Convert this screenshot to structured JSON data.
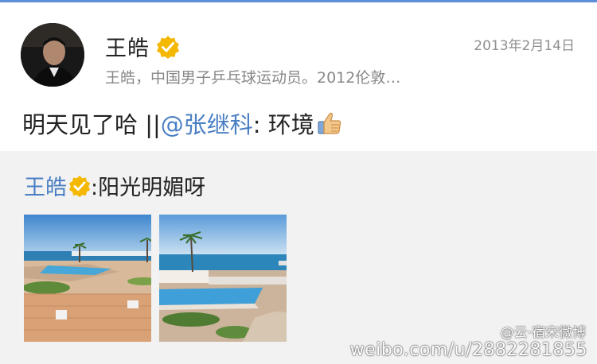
{
  "post": {
    "user_name": "王皓",
    "time": "2013年2月14日",
    "description": "王皓，中国男子乒乓球运动员。2012伦敦…",
    "text_before": "明天见了哈 || ",
    "mention": "@张继科",
    "text_after": ": 环境"
  },
  "repost": {
    "user_name": "王皓",
    "text": ":阳光明媚呀"
  },
  "watermark": {
    "logo": "@云·宿宋微博",
    "url": "weibo.com/u/2882281855"
  },
  "colors": {
    "link": "#4a7fc4",
    "badge": "#f5b800",
    "repost_bg": "#f2f2f2"
  }
}
